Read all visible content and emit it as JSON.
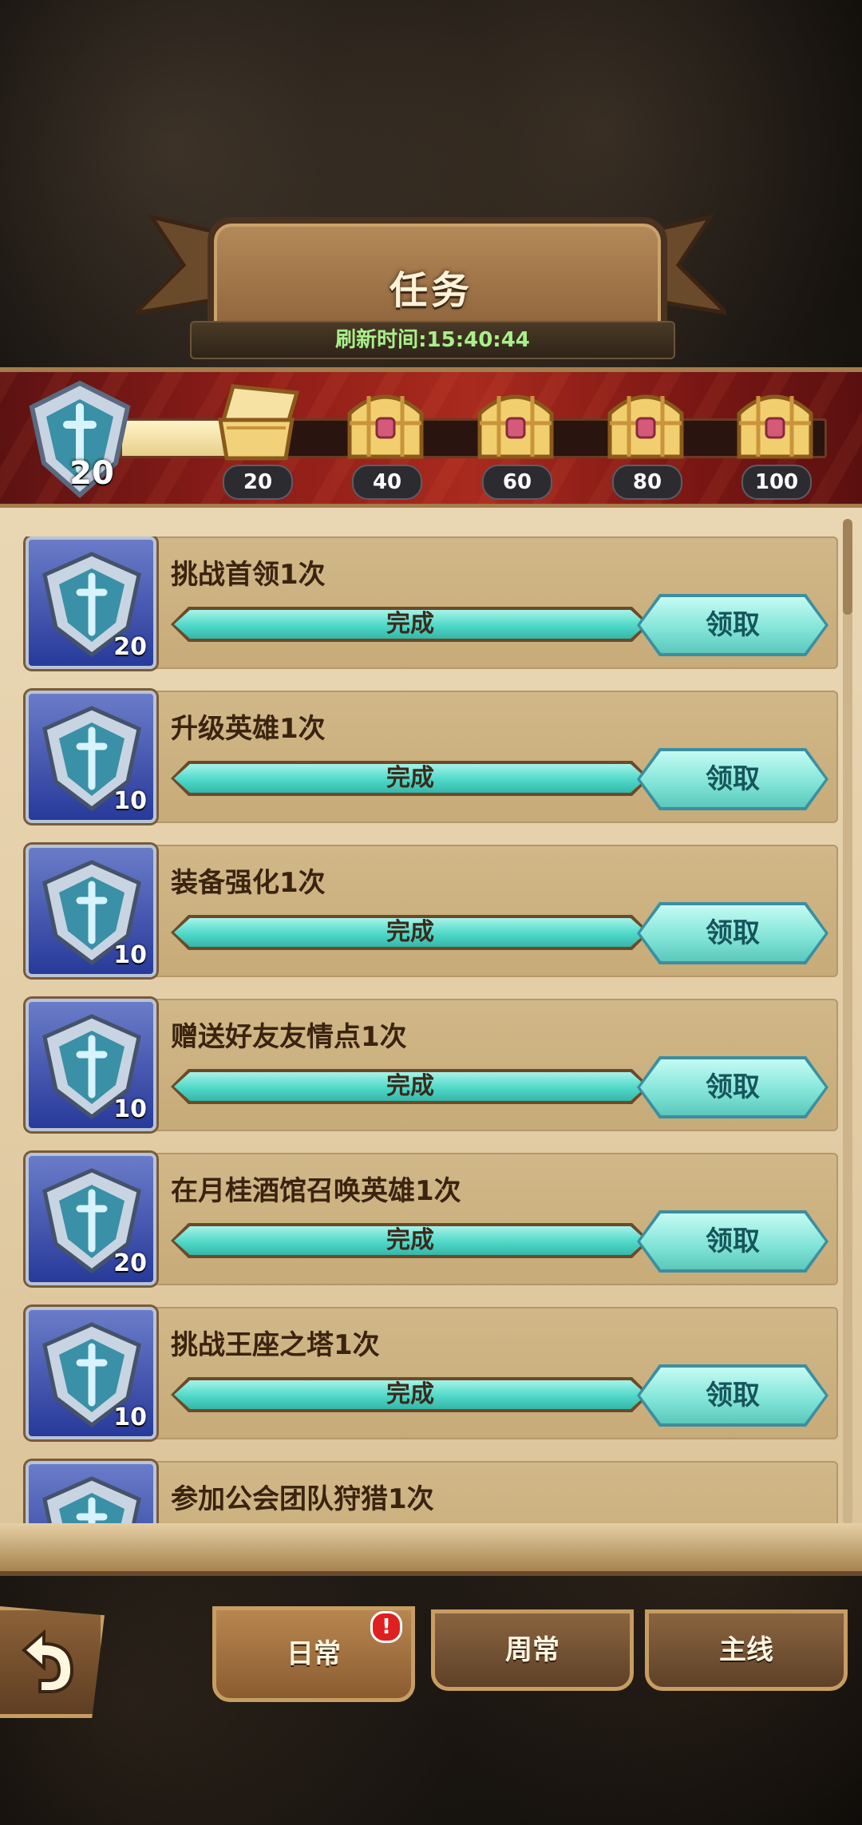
{
  "header": {
    "title": "任务",
    "refresh_label": "刷新时间:",
    "refresh_time": "15:40:44"
  },
  "activity": {
    "level": "20",
    "progress_fraction": 0.2,
    "milestones": [
      "20",
      "40",
      "60",
      "80",
      "100"
    ],
    "milestone_states": [
      "opened",
      "closed",
      "closed",
      "closed",
      "closed"
    ]
  },
  "tasks": [
    {
      "title": "挑战首领1次",
      "points": "20",
      "status": "完成",
      "button": "领取"
    },
    {
      "title": "升级英雄1次",
      "points": "10",
      "status": "完成",
      "button": "领取"
    },
    {
      "title": "装备强化1次",
      "points": "10",
      "status": "完成",
      "button": "领取"
    },
    {
      "title": "赠送好友友情点1次",
      "points": "10",
      "status": "完成",
      "button": "领取"
    },
    {
      "title": "在月桂酒馆召唤英雄1次",
      "points": "20",
      "status": "完成",
      "button": "领取"
    },
    {
      "title": "挑战王座之塔1次",
      "points": "10",
      "status": "完成",
      "button": "领取"
    },
    {
      "title": "参加公会团队狩猎1次",
      "points": "",
      "status": "",
      "button": ""
    }
  ],
  "tabs": [
    {
      "label": "日常",
      "active": true
    },
    {
      "label": "周常",
      "active": false
    },
    {
      "label": "主线",
      "active": false
    }
  ],
  "badge": "!",
  "colors": {
    "accent": "#4fd8c8",
    "band": "#a92a1e",
    "panel": "#e9d7b4"
  }
}
